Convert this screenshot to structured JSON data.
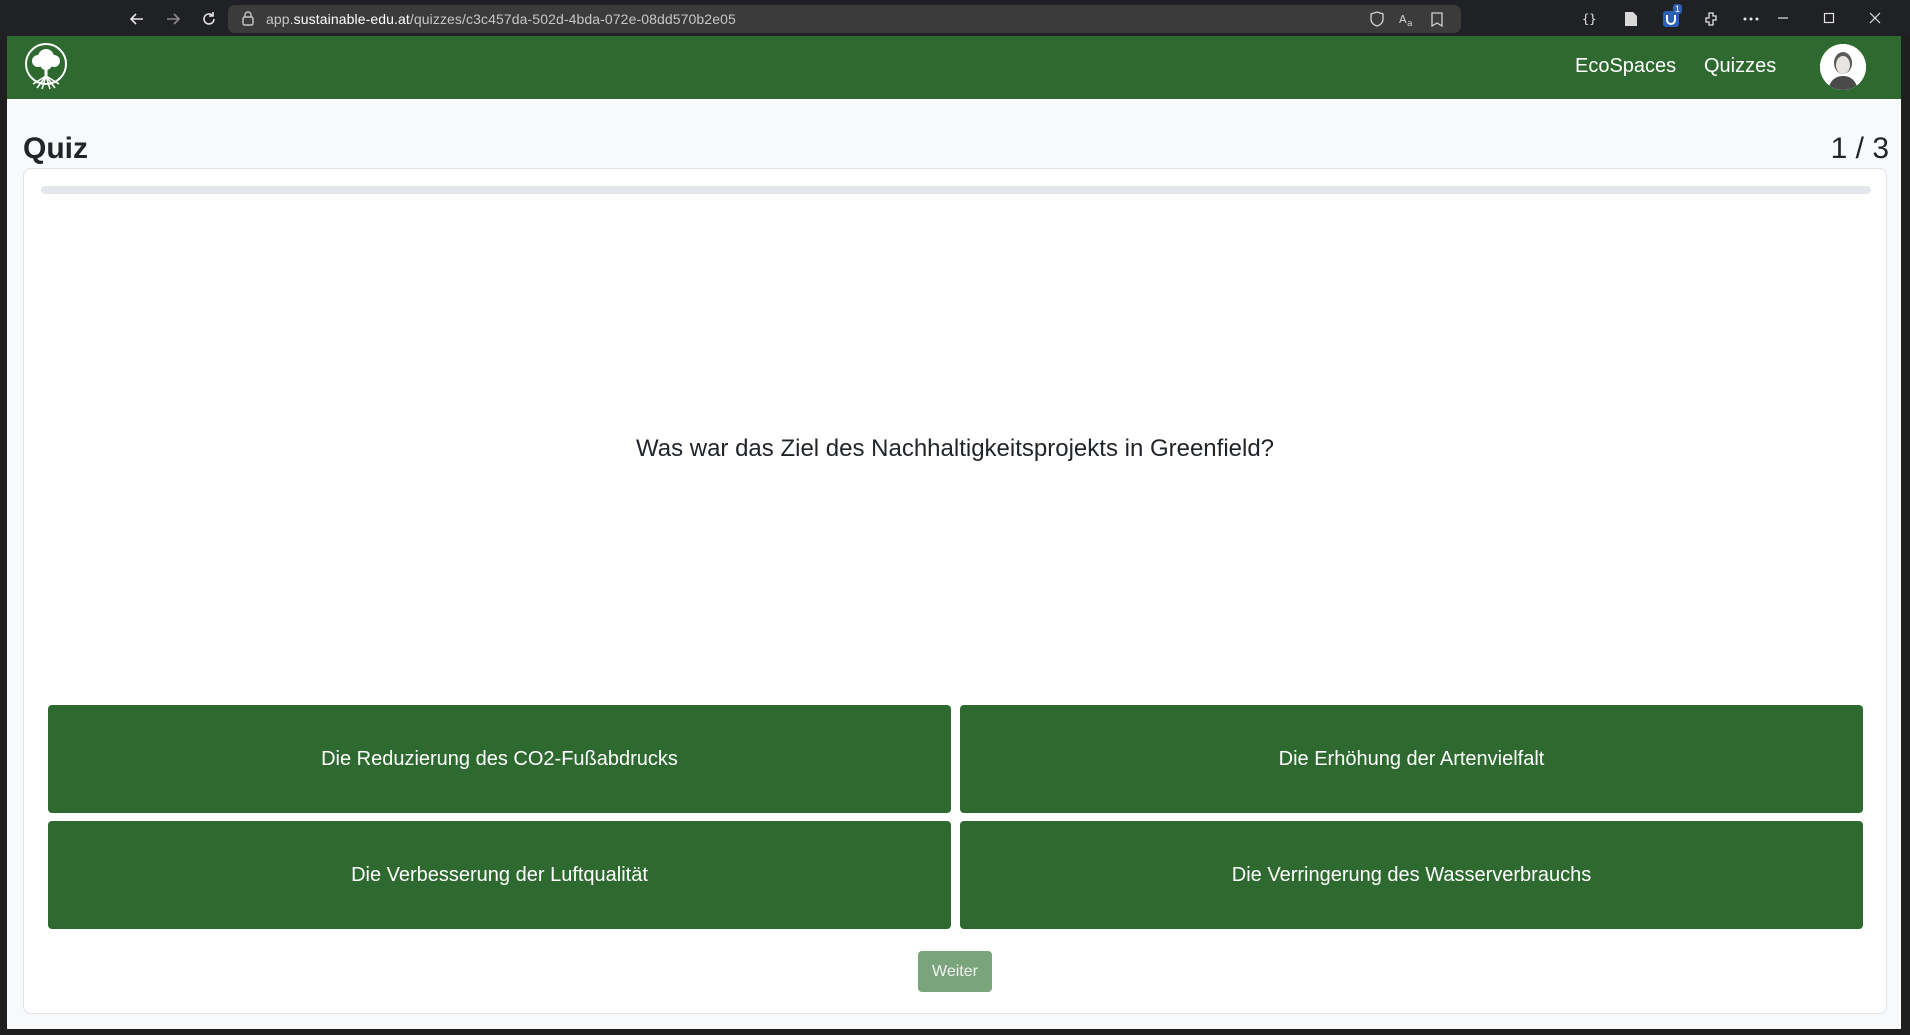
{
  "browser": {
    "url_prefix": "app.",
    "url_host": "sustainable-edu.at",
    "url_path": "/quizzes/c3c457da-502d-4bda-072e-08dd570b2e05",
    "extension_badge": "1"
  },
  "header": {
    "nav": [
      {
        "label": "EcoSpaces"
      },
      {
        "label": "Quizzes"
      }
    ],
    "colors": {
      "brand": "#2e6a30"
    }
  },
  "quiz": {
    "title": "Quiz",
    "progress_text": "1 / 3",
    "progress_fraction": 0,
    "question": "Was war das Ziel des Nachhaltigkeitsprojekts in Greenfield?",
    "answers": [
      {
        "label": "Die Reduzierung des CO2-Fußabdrucks"
      },
      {
        "label": "Die Erhöhung der Artenvielfalt"
      },
      {
        "label": "Die Verbesserung der Luftqualität"
      },
      {
        "label": "Die Verringerung des Wasserverbrauchs"
      }
    ],
    "next_label": "Weiter",
    "next_disabled": true
  }
}
